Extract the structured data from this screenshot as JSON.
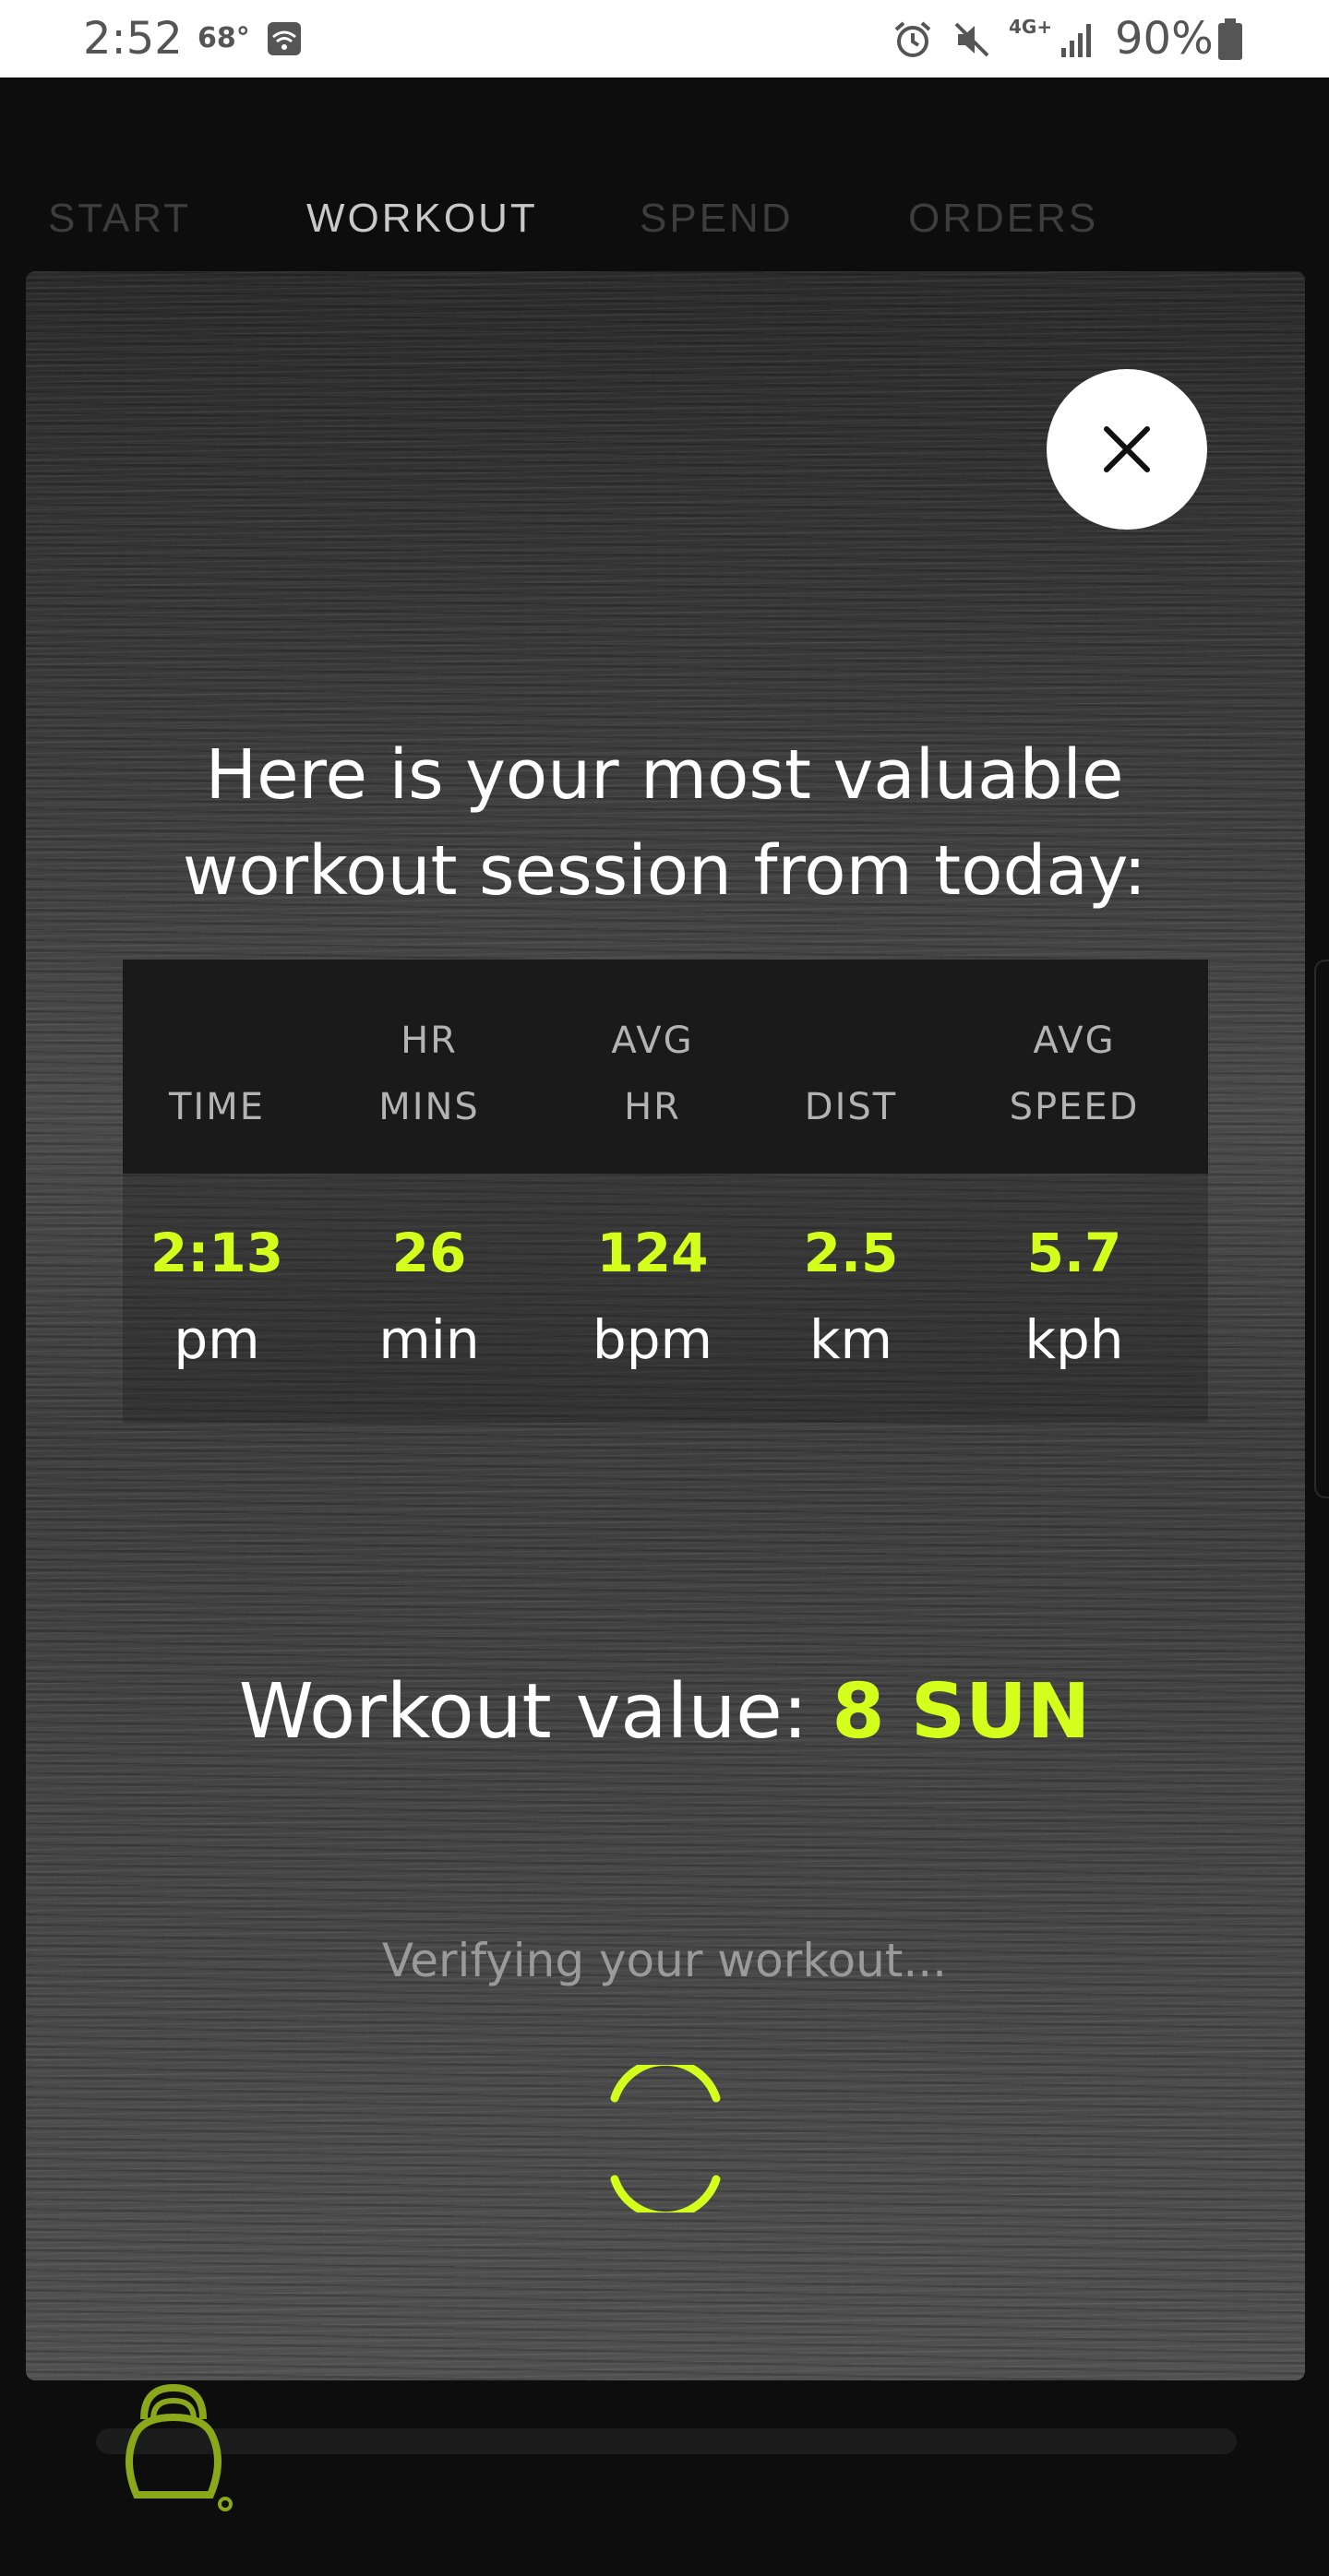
{
  "status_bar": {
    "time": "2:52",
    "temperature": "68°",
    "network": "4G+",
    "battery": "90%"
  },
  "tabs": [
    {
      "label": "START",
      "active": false
    },
    {
      "label": "WORKOUT",
      "active": true
    },
    {
      "label": "SPEND",
      "active": false
    },
    {
      "label": "ORDERS",
      "active": false
    }
  ],
  "modal": {
    "headline_line1": "Here is your most valuable",
    "headline_line2": "workout session from today:",
    "columns": [
      {
        "head1": "",
        "head2": "TIME",
        "value": "2:13",
        "unit": "pm"
      },
      {
        "head1": "HR",
        "head2": "MINS",
        "value": "26",
        "unit": "min"
      },
      {
        "head1": "AVG",
        "head2": "HR",
        "value": "124",
        "unit": "bpm"
      },
      {
        "head1": "",
        "head2": "DIST",
        "value": "2.5",
        "unit": "km"
      },
      {
        "head1": "AVG",
        "head2": "SPEED",
        "value": "5.7",
        "unit": "kph"
      }
    ],
    "workout_value_label": "Workout value: ",
    "workout_value_amount": "8 SUN",
    "verifying_text": "Verifying your workout..."
  },
  "colors": {
    "accent": "#d4ff1c",
    "background": "#0d0d0d"
  },
  "icons": {
    "close": "close-icon",
    "spinner": "loading-spinner-icon",
    "kettlebell": "kettlebell-icon"
  }
}
